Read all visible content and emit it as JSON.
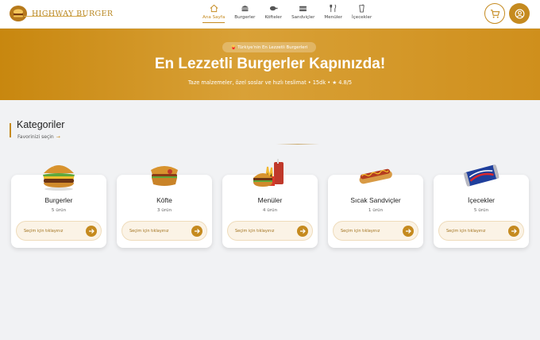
{
  "brand": {
    "name": "HIGHWAY BURGER",
    "logo_icon": "burger-logo-icon",
    "accent_color": "#c58a1f"
  },
  "nav": {
    "items": [
      {
        "label": "Ana Sayfa",
        "icon": "home-icon",
        "active": true
      },
      {
        "label": "Burgerler",
        "icon": "burger-icon",
        "active": false
      },
      {
        "label": "Köfteler",
        "icon": "meat-icon",
        "active": false
      },
      {
        "label": "Sandviçler",
        "icon": "sandwich-icon",
        "active": false
      },
      {
        "label": "Menüler",
        "icon": "utensils-icon",
        "active": false
      },
      {
        "label": "İçecekler",
        "icon": "drink-icon",
        "active": false
      }
    ],
    "cart_icon": "cart-icon",
    "profile_icon": "user-icon"
  },
  "hero": {
    "pill": "🍟 Türkiye'nin En Lezzetli Burgerleri",
    "title": "En Lezzetli Burgerler Kapınızda!",
    "subtitle": "Taze malzemeler, özel soslar ve hızlı teslimat • 15dk • ★ 4.8/5"
  },
  "categories": {
    "title": "Kategoriler",
    "subtitle": "Favorinizi seçin",
    "items": [
      {
        "name": "Burgerler",
        "count": "5 ürün",
        "button": "Seçim için tıklayınız",
        "image": "burger-image"
      },
      {
        "name": "Köfte",
        "count": "3 ürün",
        "button": "Seçim için tıklayınız",
        "image": "kofte-sandwich-image"
      },
      {
        "name": "Menüler",
        "count": "4 ürün",
        "button": "Seçim için tıklayınız",
        "image": "menu-combo-image"
      },
      {
        "name": "Sıcak Sandviçler",
        "count": "1 ürün",
        "button": "Seçim için tıklayınız",
        "image": "hotdog-image"
      },
      {
        "name": "İçecekler",
        "count": "5 ürün",
        "button": "Seçim için tıklayınız",
        "image": "soda-can-image"
      }
    ]
  }
}
